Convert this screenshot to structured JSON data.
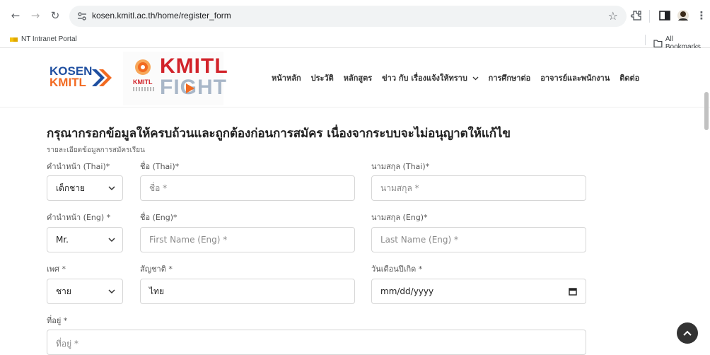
{
  "browser": {
    "url": "kosen.kmitl.ac.th/home/register_form",
    "bookmarks": [
      {
        "label": "NT Intranet Portal"
      }
    ],
    "all_bookmarks_label": "All Bookmarks"
  },
  "header": {
    "logo_kosen_line1": "KOSEN",
    "logo_kosen_line2": "KMITL",
    "logo_fight_top": "KMITL",
    "logo_fight_bottom": "FIGHT",
    "logo_fight_badge": "KMITL",
    "nav": [
      {
        "label": "หน้าหลัก"
      },
      {
        "label": "ประวัติ"
      },
      {
        "label": "หลักสูตร"
      },
      {
        "label": "ข่าว กับ เรื่องแจ้งให้ทราบ"
      },
      {
        "label": "การศึกษาต่อ"
      },
      {
        "label": "อาจารย์และพนักงาน"
      },
      {
        "label": "ติดต่อ"
      }
    ]
  },
  "form": {
    "heading": "กรุณากรอกข้อมูลให้ครบถ้วนและถูกต้องก่อนการสมัคร เนื่องจากระบบจะไม่อนุญาตให้แก้ไข",
    "section_label": "รายละเอียดข้อมูลการสมัครเรียน",
    "title_th": {
      "label": "คำนำหน้า (Thai)*",
      "value": "เด็กชาย"
    },
    "first_name_th": {
      "label": "ชื่อ (Thai)*",
      "placeholder": "ชื่อ *"
    },
    "last_name_th": {
      "label": "นามสกุล (Thai)*",
      "placeholder": "นามสกุล *"
    },
    "title_en": {
      "label": "คำนำหน้า (Eng) *",
      "value": "Mr."
    },
    "first_name_en": {
      "label": "ชื่อ (Eng)*",
      "placeholder": "First Name (Eng) *"
    },
    "last_name_en": {
      "label": "นามสกุล (Eng)*",
      "placeholder": "Last Name (Eng) *"
    },
    "gender": {
      "label": "เพศ *",
      "value": "ชาย"
    },
    "nationality": {
      "label": "สัญชาติ *",
      "value": "ไทย"
    },
    "birthdate": {
      "label": "วันเดือนปีเกิด *",
      "placeholder": "mm/dd/yyyy"
    },
    "address": {
      "label": "ที่อยู่ *",
      "placeholder": "ที่อยู่ *"
    }
  },
  "colors": {
    "kosen_blue": "#1f4fa0",
    "kosen_orange": "#f26a21",
    "fight_red": "#d2232a"
  }
}
